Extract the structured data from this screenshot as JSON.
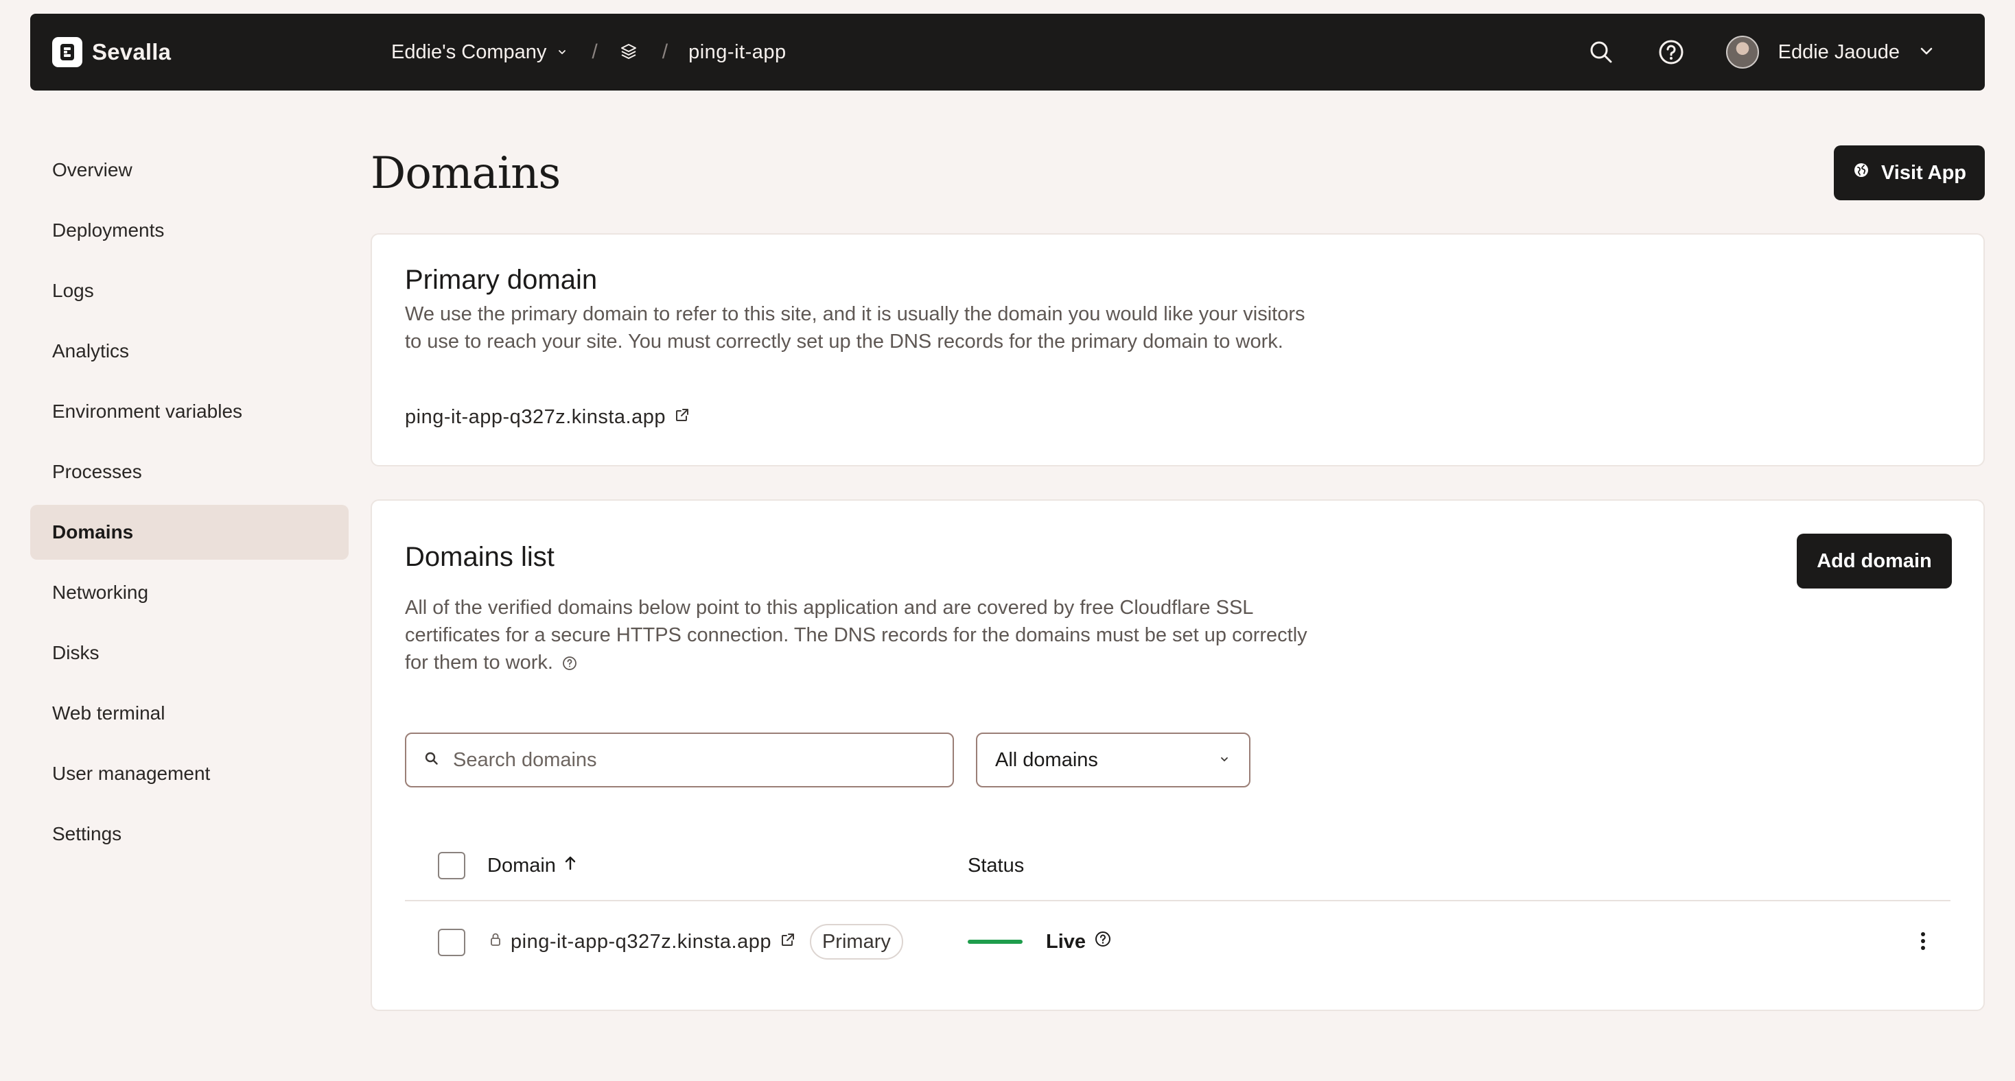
{
  "header": {
    "brand": "Sevalla",
    "company": "Eddie's Company",
    "separator": "/",
    "app_name": "ping-it-app",
    "user_name": "Eddie Jaoude"
  },
  "sidebar": {
    "items": [
      {
        "label": "Overview"
      },
      {
        "label": "Deployments"
      },
      {
        "label": "Logs"
      },
      {
        "label": "Analytics"
      },
      {
        "label": "Environment variables"
      },
      {
        "label": "Processes"
      },
      {
        "label": "Domains",
        "active": true
      },
      {
        "label": "Networking"
      },
      {
        "label": "Disks"
      },
      {
        "label": "Web terminal"
      },
      {
        "label": "User management"
      },
      {
        "label": "Settings"
      }
    ]
  },
  "page": {
    "title": "Domains",
    "visit_button": "Visit App"
  },
  "primary_domain": {
    "title": "Primary domain",
    "description": "We use the primary domain to refer to this site, and it is usually the domain you would like your visitors to use to reach your site. You must correctly set up the DNS records for the primary domain to work.",
    "domain": "ping-it-app-q327z.kinsta.app"
  },
  "domains_list": {
    "title": "Domains list",
    "add_button": "Add domain",
    "description": "All of the verified domains below point to this application and are covered by free Cloudflare SSL certificates for a secure HTTPS connection. The DNS records for the domains must be set up correctly for them to work.",
    "search_placeholder": "Search domains",
    "filter_value": "All domains",
    "columns": {
      "domain": "Domain",
      "status": "Status"
    },
    "rows": [
      {
        "domain": "ping-it-app-q327z.kinsta.app",
        "badge": "Primary",
        "status": "Live"
      }
    ]
  },
  "colors": {
    "topbar_bg": "#1b1a19",
    "page_bg": "#f8f3f1",
    "active_nav_bg": "#ebe0da",
    "status_live": "#1f9d4c"
  }
}
